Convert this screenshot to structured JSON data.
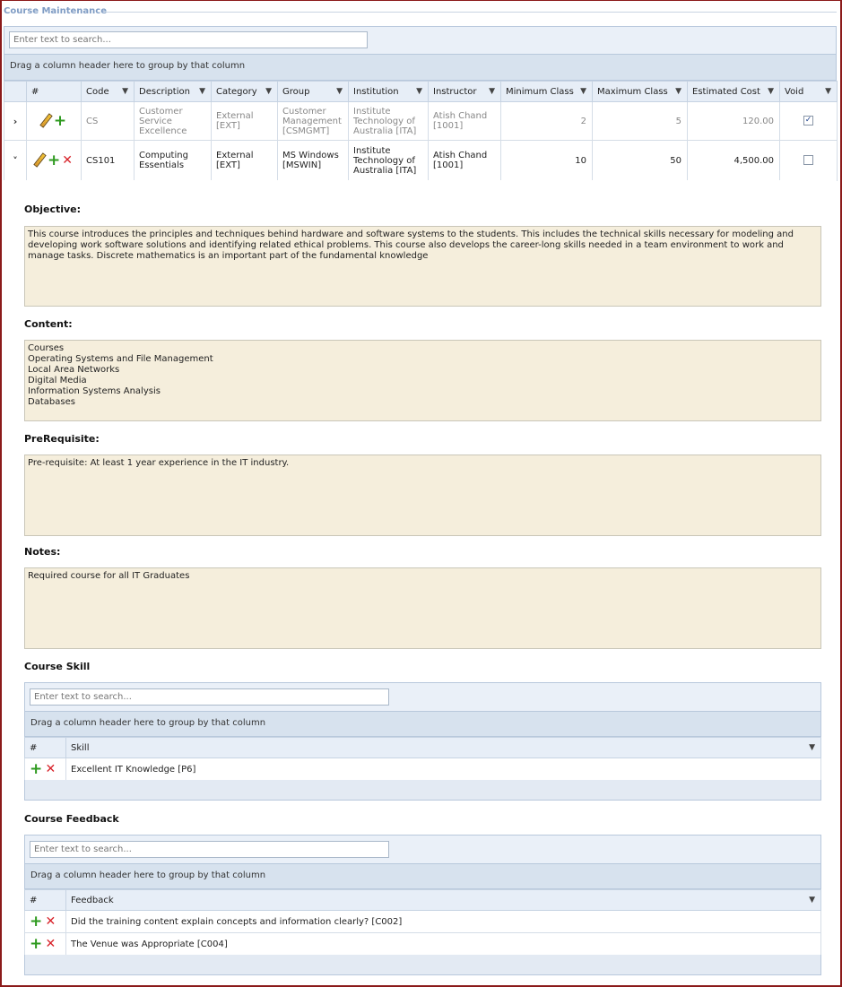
{
  "app": {
    "title": "Course Maintenance"
  },
  "search": {
    "placeholder": "Enter text to search..."
  },
  "group_hint": "Drag a column header here to group by that column",
  "main_grid": {
    "columns": [
      "#",
      "Code",
      "Description",
      "Category",
      "Group",
      "Institution",
      "Instructor",
      "Minimum Class",
      "Maximum Class",
      "Estimated Cost",
      "Void"
    ],
    "rows": [
      {
        "expander": "›",
        "code": "CS",
        "description": "Customer Service Excellence",
        "category": "External [EXT]",
        "group": "Customer Management [CSMGMT]",
        "institution": "Institute Technology of Australia [ITA]",
        "instructor": "Atish Chand [1001]",
        "min_class": "2",
        "max_class": "5",
        "cost": "120.00",
        "void_mark": "✓"
      },
      {
        "expander": "˅",
        "code": "CS101",
        "description": "Computing Essentials",
        "category": "External [EXT]",
        "group": "MS Windows [MSWIN]",
        "institution": "Institute Technology of Australia [ITA]",
        "instructor": "Atish Chand [1001]",
        "min_class": "10",
        "max_class": "50",
        "cost": "4,500.00",
        "void_mark": ""
      }
    ]
  },
  "detail": {
    "objective_label": "Objective:",
    "objective_text": "This course introduces the principles and techniques behind hardware and software systems to the students. This includes the technical skills necessary for modeling and developing work software solutions and identifying related ethical problems. This course also develops the career-long skills needed in a team environment to work and manage tasks. Discrete mathematics is an important part of the fundamental knowledge",
    "content_label": "Content:",
    "content_text": "Courses\nOperating Systems and File  Management\nLocal Area Networks\nDigital Media\nInformation Systems Analysis\nDatabases",
    "prerequisite_label": "PreRequisite:",
    "prerequisite_text": "Pre-requisite: At least 1 year experience in the IT industry.",
    "notes_label": "Notes:",
    "notes_text": "Required course for all IT Graduates"
  },
  "course_skill": {
    "title": "Course Skill",
    "columns": [
      "#",
      "Skill"
    ],
    "rows": [
      "Excellent IT Knowledge [P6]"
    ]
  },
  "course_feedback": {
    "title": "Course Feedback",
    "columns": [
      "#",
      "Feedback"
    ],
    "rows": [
      "Did the training content explain concepts and information clearly? [C002]",
      "The Venue was Appropriate [C004]"
    ]
  },
  "icons": {
    "filter": "filter-icon",
    "edit": "pencil-icon",
    "add": "plus-icon",
    "delete": "cross-icon",
    "accent_green": "#2e9a1f",
    "accent_red": "#d8232a",
    "memo_bg": "#f5eedc",
    "frame_border": "#8b1a1a"
  }
}
